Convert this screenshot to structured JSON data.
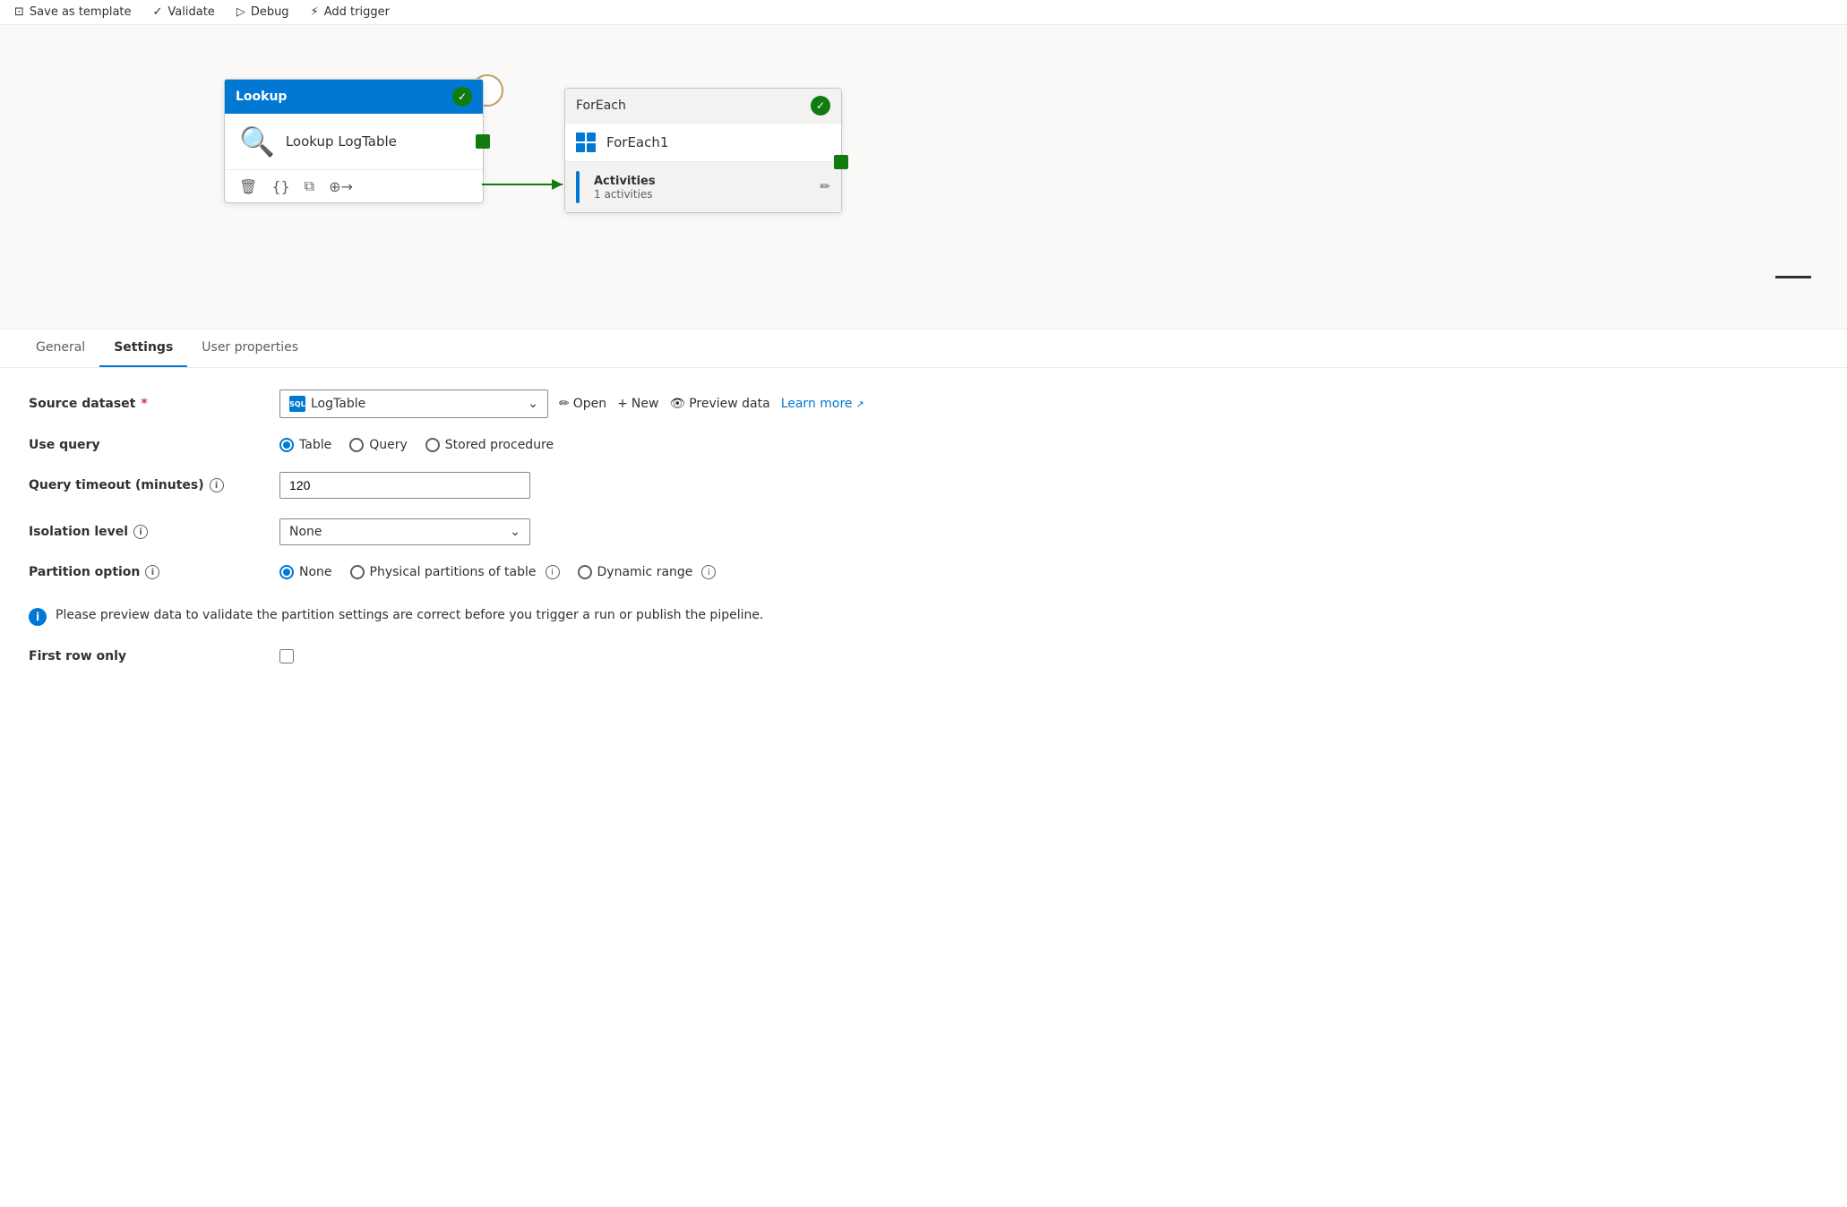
{
  "toolbar": {
    "items": [
      {
        "label": "Save as template",
        "icon": "save-template-icon"
      },
      {
        "label": "Validate",
        "icon": "validate-icon"
      },
      {
        "label": "Debug",
        "icon": "debug-icon"
      },
      {
        "label": "Add trigger",
        "icon": "add-trigger-icon"
      }
    ]
  },
  "canvas": {
    "lookup_node": {
      "title": "Lookup",
      "body_label": "Lookup LogTable",
      "actions": [
        "delete",
        "code",
        "copy",
        "add"
      ]
    },
    "foreach_node": {
      "title": "ForEach",
      "body_label": "ForEach1",
      "activities_label": "Activities",
      "activities_count": "1 activities"
    }
  },
  "tabs": [
    {
      "label": "General",
      "active": false
    },
    {
      "label": "Settings",
      "active": true
    },
    {
      "label": "User properties",
      "active": false
    }
  ],
  "settings": {
    "source_dataset": {
      "label": "Source dataset",
      "required": true,
      "value": "LogTable",
      "actions": {
        "open_label": "Open",
        "new_label": "New",
        "preview_label": "Preview data",
        "learn_more_label": "Learn more"
      }
    },
    "use_query": {
      "label": "Use query",
      "options": [
        {
          "label": "Table",
          "checked": true
        },
        {
          "label": "Query",
          "checked": false
        },
        {
          "label": "Stored procedure",
          "checked": false
        }
      ]
    },
    "query_timeout": {
      "label": "Query timeout (minutes)",
      "value": "120"
    },
    "isolation_level": {
      "label": "Isolation level",
      "value": "None"
    },
    "partition_option": {
      "label": "Partition option",
      "options": [
        {
          "label": "None",
          "checked": true
        },
        {
          "label": "Physical partitions of table",
          "checked": false
        },
        {
          "label": "Dynamic range",
          "checked": false
        }
      ]
    },
    "info_message": "Please preview data to validate the partition settings are correct before you trigger a run or publish the pipeline.",
    "first_row_only": {
      "label": "First row only",
      "checked": false
    }
  }
}
